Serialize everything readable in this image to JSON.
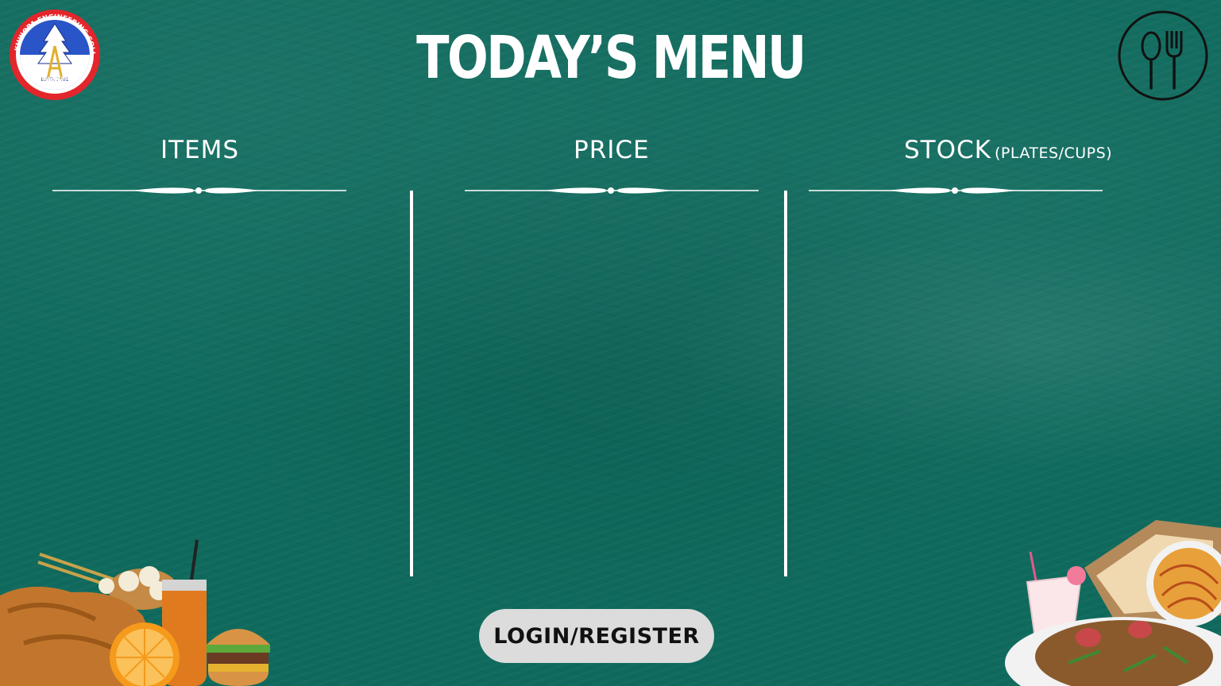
{
  "header": {
    "title": "TODAY’S MENU",
    "logo_icon": "college-logo-icon",
    "utensils_icon": "spoon-fork-icon"
  },
  "logo": {
    "ring_text": "KHWOPA ENGINEERING COLLEGE",
    "estd": "ESTD. 2001",
    "place": "BHAKTAPUR"
  },
  "columns": [
    {
      "label": "ITEMS",
      "sub": ""
    },
    {
      "label": "PRICE",
      "sub": ""
    },
    {
      "label": "STOCK",
      "sub": "(PLATES/CUPS)"
    }
  ],
  "actions": {
    "login_label": "LOGIN/REGISTER"
  },
  "colors": {
    "background": "#0f6a5d",
    "text": "#ffffff",
    "button_bg": "#dcdcdc",
    "logo_ring": "#e3262b"
  },
  "decor": {
    "left_food": "fried-chicken-momo-juice-burger-image",
    "right_food": "noodles-fried-rice-drink-image"
  }
}
